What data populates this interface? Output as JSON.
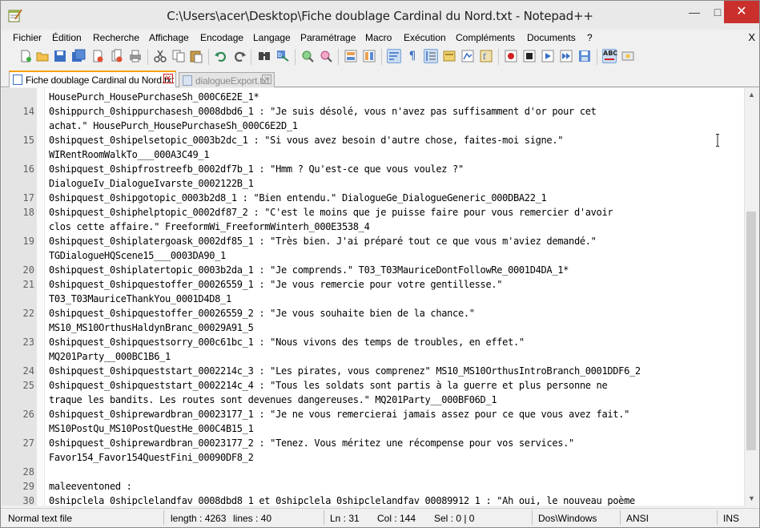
{
  "window": {
    "title": "C:\\Users\\acer\\Desktop\\Fiche doublage Cardinal du Nord.txt - Notepad++",
    "minimize": "—",
    "maximize": "□",
    "close": "✕"
  },
  "menu": {
    "items": [
      "Fichier",
      "Édition",
      "Recherche",
      "Affichage",
      "Encodage",
      "Langage",
      "Paramétrage",
      "Macro",
      "Exécution",
      "Compléments",
      "Documents",
      "?"
    ],
    "close": "X"
  },
  "toolbar": {
    "icons": [
      "new-file-icon",
      "open-file-icon",
      "save-icon",
      "save-all-icon",
      "close-icon",
      "close-all-icon",
      "print-icon",
      "cut-icon",
      "copy-icon",
      "paste-icon",
      "undo-icon",
      "redo-icon",
      "find-icon",
      "replace-icon",
      "zoom-in-icon",
      "zoom-out-icon",
      "sync-vertical-icon",
      "sync-horizontal-icon",
      "word-wrap-icon",
      "show-all-chars-icon",
      "indent-guide-icon",
      "language-icon",
      "doc-map-icon",
      "function-list-icon",
      "record-macro-icon",
      "stop-macro-icon",
      "play-macro-icon",
      "run-macro-multiple-icon",
      "save-macro-icon",
      "spell-check-icon",
      "spell-options-icon"
    ]
  },
  "tabs": [
    {
      "label": "Fiche doublage Cardinal du Nord.txt",
      "active": true
    },
    {
      "label": "dialogueExport.txt",
      "active": false
    }
  ],
  "editor": {
    "lines": [
      {
        "num": "",
        "text": "HousePurch_HousePurchaseSh_000C6E2E_1*"
      },
      {
        "num": "14",
        "text": "0shippurch_0shippurchasesh_0008dbd6_1 : \"Je suis désolé, vous n'avez pas suffisamment d'or pour cet"
      },
      {
        "num": "",
        "text": "achat.\" HousePurch_HousePurchaseSh_000C6E2D_1"
      },
      {
        "num": "15",
        "text": "0shipquest_0shipelsetopic_0003b2dc_1 : \"Si vous avez besoin d'autre chose, faites-moi signe.\""
      },
      {
        "num": "",
        "text": "WIRentRoomWalkTo___000A3C49_1"
      },
      {
        "num": "16",
        "text": "0shipquest_0shipfrostreefb_0002df7b_1 : \"Hmm ? Qu'est-ce que vous voulez ?\""
      },
      {
        "num": "",
        "text": "DialogueIv_DialogueIvarste_0002122B_1"
      },
      {
        "num": "17",
        "text": "0shipquest_0shipgotopic_0003b2d8_1 : \"Bien entendu.\" DialogueGe_DialogueGeneric_000DBA22_1"
      },
      {
        "num": "18",
        "text": "0shipquest_0shiphelptopic_0002df87_2 : \"C'est le moins que je puisse faire pour vous remercier d'avoir"
      },
      {
        "num": "",
        "text": "clos cette affaire.\" FreeformWi_FreeformWinterh_000E3538_4"
      },
      {
        "num": "19",
        "text": "0shipquest_0shiplatergoask_0002df85_1 : \"Très bien. J'ai préparé tout ce que vous m'aviez demandé.\""
      },
      {
        "num": "",
        "text": "TGDialogueHQScene15___0003DA90_1"
      },
      {
        "num": "20",
        "text": "0shipquest_0shiplatertopic_0003b2da_1 : \"Je comprends.\" T03_T03MauriceDontFollowRe_0001D4DA_1*"
      },
      {
        "num": "21",
        "text": "0shipquest_0shipquestoffer_00026559_1 : \"Je vous remercie pour votre gentillesse.\""
      },
      {
        "num": "",
        "text": "T03_T03MauriceThankYou_0001D4D8_1"
      },
      {
        "num": "22",
        "text": "0shipquest_0shipquestoffer_00026559_2 : \"Je vous souhaite bien de la chance.\""
      },
      {
        "num": "",
        "text": "MS10_MS10OrthusHaldynBranc_00029A91_5"
      },
      {
        "num": "23",
        "text": "0shipquest_0shipquestsorry_000c61bc_1 : \"Nous vivons des temps de troubles, en effet.\""
      },
      {
        "num": "",
        "text": "MQ201Party__000BC1B6_1"
      },
      {
        "num": "24",
        "text": "0shipquest_0shipqueststart_0002214c_3 : \"Les pirates, vous comprenez\" MS10_MS10OrthusIntroBranch_0001DDF6_2"
      },
      {
        "num": "25",
        "text": "0shipquest_0shipqueststart_0002214c_4 : \"Tous les soldats sont partis à la guerre et plus personne ne"
      },
      {
        "num": "",
        "text": "traque les bandits. Les routes sont devenues dangereuses.\" MQ201Party__000BF06D_1"
      },
      {
        "num": "26",
        "text": "0shipquest_0shiprewardbran_00023177_1 : \"Je ne vous remercierai jamais assez pour ce que vous avez fait.\""
      },
      {
        "num": "",
        "text": "MS10PostQu_MS10PostQuestHe_000C4B15_1"
      },
      {
        "num": "27",
        "text": "0shipquest_0shiprewardbran_00023177_2 : \"Tenez. Vous méritez une récompense pour vos services.\""
      },
      {
        "num": "",
        "text": "Favor154_Favor154QuestFini_00090DF8_2"
      },
      {
        "num": "28",
        "text": ""
      },
      {
        "num": "29",
        "text": "maleeventoned :"
      },
      {
        "num": "30",
        "text": "0shipclela_0shipclelandfav_0008dbd8_1 et 0shipclela_0shipclelandfav_00089912_1 : \"Ah oui, le nouveau poème"
      }
    ]
  },
  "status": {
    "file_type": "Normal text file",
    "length": "length : 4263",
    "lines": "lines : 40",
    "ln": "Ln : 31",
    "col": "Col : 144",
    "sel": "Sel : 0 | 0",
    "eol": "Dos\\Windows",
    "encoding": "ANSI",
    "mode": "INS"
  }
}
